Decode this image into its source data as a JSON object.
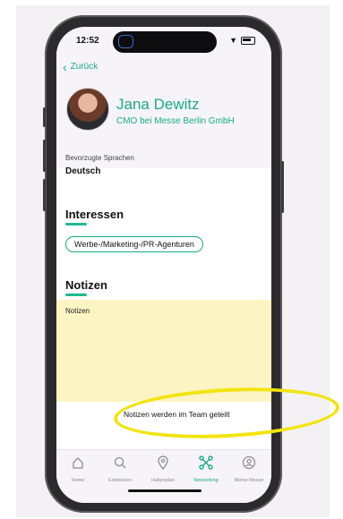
{
  "status_bar": {
    "time": "12:52"
  },
  "nav": {
    "back_label": "Zurück"
  },
  "profile": {
    "name": "Jana Dewitz",
    "role": "CMO bei Messe Berlin GmbH"
  },
  "languages": {
    "label": "Bevorzugte Sprachen",
    "value": "Deutsch"
  },
  "interests": {
    "title": "Interessen",
    "chips": [
      "Werbe-/Marketing-/PR-Agenturen"
    ]
  },
  "notes": {
    "title": "Notizen",
    "placeholder": "Notizen",
    "shared_text": "Notizen werden im Team geteilt"
  },
  "tabs": [
    {
      "label": "Home",
      "icon": "home-icon",
      "active": false
    },
    {
      "label": "Entdecken",
      "icon": "search-icon",
      "active": false
    },
    {
      "label": "Hallenplan",
      "icon": "map-pin-icon",
      "active": false
    },
    {
      "label": "Networking",
      "icon": "network-icon",
      "active": true
    },
    {
      "label": "Meine Messe",
      "icon": "profile-icon",
      "active": false
    }
  ],
  "colors": {
    "accent": "#1aa98c",
    "notes_bg": "#fcf4c2",
    "highlight": "#f2e40d"
  }
}
